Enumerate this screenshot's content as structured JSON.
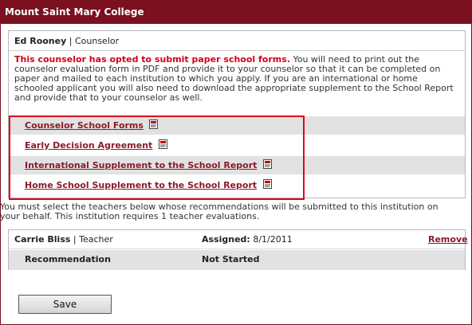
{
  "header": {
    "title": "Mount Saint Mary College"
  },
  "counselor": {
    "name": "Ed Rooney",
    "separator": " | ",
    "role": "Counselor",
    "notice_bold": "This counselor has opted to submit paper school forms.",
    "notice_rest": " You will need to print out the counselor evaluation form in PDF and provide it to your counselor so that it can be completed on paper and mailed to each institution to which you apply. If you are an international or home schooled applicant you will also need to download the appropriate supplement to the School Report and provide that to your counselor as well.",
    "forms": [
      {
        "label": "Counselor School Forms",
        "icon": "pdf-icon"
      },
      {
        "label": "Early Decision Agreement",
        "icon": "pdf-icon"
      },
      {
        "label": "International Supplement to the School Report",
        "icon": "pdf-icon"
      },
      {
        "label": "Home School Supplement to the School Report",
        "icon": "pdf-icon"
      }
    ]
  },
  "teachers": {
    "instructions_line1": "You must select the teachers below whose recommendations will be submitted to this institution on",
    "instructions_line2": "your behalf. This institution requires 1 teacher evaluations.",
    "rows": [
      {
        "name": "Carrie Bliss",
        "separator": " | ",
        "role": "Teacher",
        "assigned_label": "Assigned:",
        "assigned_value": " 8/1/2011",
        "remove_label": "Remove"
      }
    ],
    "recommendation_label": "Recommendation",
    "recommendation_status": "Not Started"
  },
  "actions": {
    "save_label": "Save"
  },
  "colors": {
    "header_bg": "#7b1020",
    "notice_red": "#d4001a",
    "link": "#8b1a2a",
    "highlight": "#e0001b"
  }
}
